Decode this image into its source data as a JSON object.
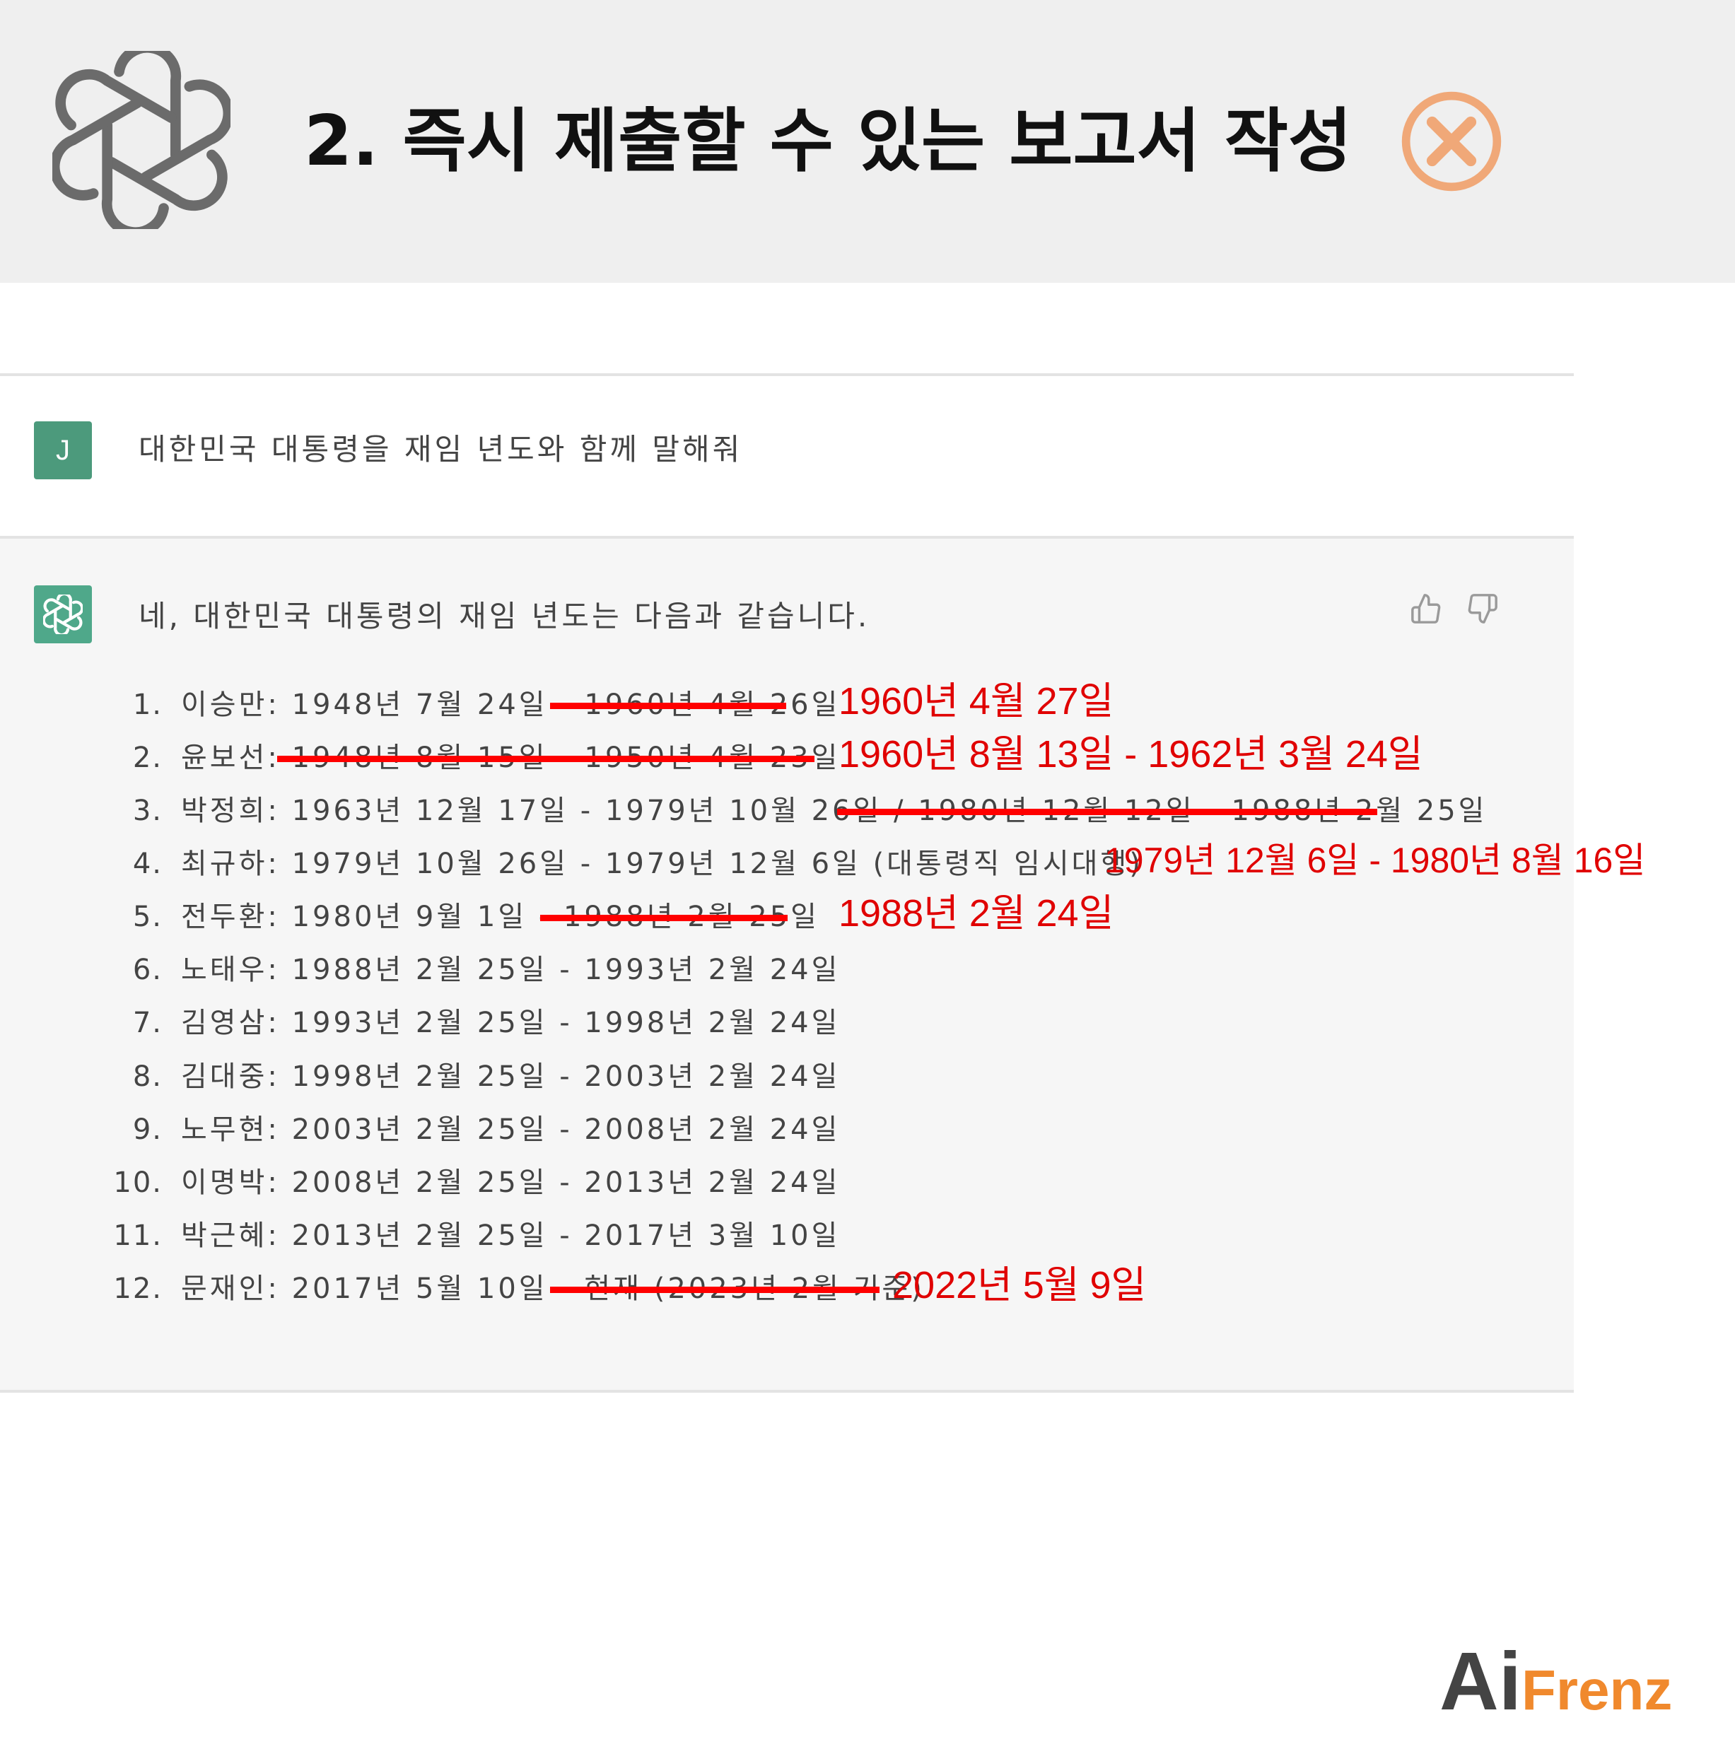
{
  "header": {
    "title": "2. 즉시 제출할 수 있는 보고서 작성",
    "logo_icon": "openai-logo-icon",
    "status_icon": "x-circle-icon",
    "status_color": "#f0a878"
  },
  "user_message": {
    "avatar": "J",
    "text": "대한민국 대통령을 재임 년도와 함께 말해줘"
  },
  "assistant_message": {
    "intro": "네, 대한민국 대통령의 재임 년도는 다음과 같습니다.",
    "items": [
      {
        "num": "1.",
        "text": "이승만: 1948년 7월 24일 - 1960년 4월 26일",
        "correction": "1960년 4월 27일"
      },
      {
        "num": "2.",
        "text": "윤보선: 1948년 8월 15일 - 1950년 4월 23일",
        "correction": "1960년 8월 13일 - 1962년 3월 24일"
      },
      {
        "num": "3.",
        "text": "박정희: 1963년 12월 17일 - 1979년 10월 26일 / 1980년 12월 12일 - 1988년 2월 25일",
        "correction": ""
      },
      {
        "num": "4.",
        "text": "최규하: 1979년 10월 26일 - 1979년 12월 6일 (대통령직 임시대행)",
        "correction": "1979년 12월 6일 - 1980년 8월 16일"
      },
      {
        "num": "5.",
        "text": "전두환: 1980년 9월 1일 - 1988년 2월 25일",
        "correction": "1988년 2월 24일"
      },
      {
        "num": "6.",
        "text": "노태우: 1988년 2월 25일 - 1993년 2월 24일",
        "correction": ""
      },
      {
        "num": "7.",
        "text": "김영삼: 1993년 2월 25일 - 1998년 2월 24일",
        "correction": ""
      },
      {
        "num": "8.",
        "text": "김대중: 1998년 2월 25일 - 2003년 2월 24일",
        "correction": ""
      },
      {
        "num": "9.",
        "text": "노무현: 2003년 2월 25일 - 2008년 2월 24일",
        "correction": ""
      },
      {
        "num": "10.",
        "text": "이명박: 2008년 2월 25일 - 2013년 2월 24일",
        "correction": ""
      },
      {
        "num": "11.",
        "text": "박근혜: 2013년 2월 25일 - 2017년 3월 10일",
        "correction": ""
      },
      {
        "num": "12.",
        "text": "문재인: 2017년 5월 10일 - 현재 (2023년 2월 기준)",
        "correction": "2022년 5월 9일"
      }
    ],
    "feedback_icons": [
      "thumbs-up-icon",
      "thumbs-down-icon"
    ]
  },
  "annotation_color": "#e00000",
  "brand": {
    "part1": "Ai",
    "part2": "Frenz",
    "accent": "#f0892d"
  }
}
